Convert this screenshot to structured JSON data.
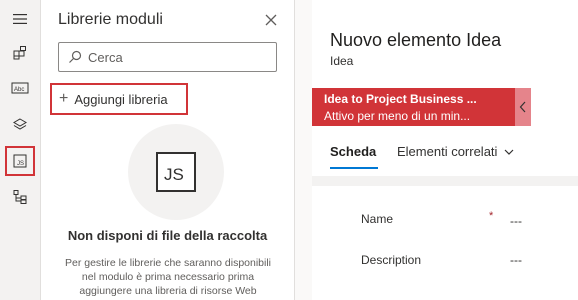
{
  "rail": {
    "items": [
      {
        "name": "hamburger-menu-icon"
      },
      {
        "name": "components-icon"
      },
      {
        "name": "table-columns-icon"
      },
      {
        "name": "layers-icon"
      },
      {
        "name": "js-library-icon"
      },
      {
        "name": "tree-view-icon"
      }
    ],
    "highlight_color": "#d13438"
  },
  "panel": {
    "title": "Librerie moduli",
    "search": {
      "placeholder": "Cerca",
      "value": ""
    },
    "add_library_label": "Aggiungi libreria",
    "empty_icon_text": "JS",
    "empty_title": "Non disponi di file della raccolta",
    "empty_description": "Per gestire le librerie che saranno disponibili nel modulo è prima necessario prima aggiungere una libreria di risorse Web"
  },
  "form": {
    "title": "Nuovo elemento Idea",
    "subtitle": "Idea",
    "process": {
      "title": "Idea to Project Business ...",
      "subtitle": "Attivo per meno di un min...",
      "color": "#d13438"
    },
    "tabs": {
      "active": "Scheda",
      "related": "Elementi correlati"
    },
    "fields": [
      {
        "label": "Name",
        "required_mark": "*",
        "value": "---"
      },
      {
        "label": "Description",
        "value": "---"
      }
    ]
  },
  "colors": {
    "accent": "#0078d4",
    "highlight": "#d13438"
  }
}
